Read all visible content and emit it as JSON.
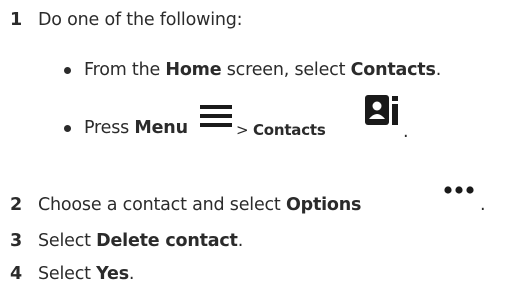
{
  "steps": [
    {
      "number": "1",
      "text": "Do one of the following:",
      "options": [
        {
          "pre": "From the ",
          "b1": "Home",
          "mid": " screen, select ",
          "b2": "Contacts",
          "post": "."
        },
        {
          "pre": "Press ",
          "b1": "Menu",
          "icon1": "menu-icon",
          "mid": " > ",
          "b2": "Contacts",
          "icon2": "contacts-icon",
          "post": "."
        }
      ]
    },
    {
      "number": "2",
      "pre": "Choose a contact and select ",
      "bold": "Options",
      "icon": "more-options-icon",
      "post": "."
    },
    {
      "number": "3",
      "pre": "Select ",
      "bold": "Delete contact",
      "post": "."
    },
    {
      "number": "4",
      "pre": "Select ",
      "bold": "Yes",
      "post": "."
    }
  ]
}
